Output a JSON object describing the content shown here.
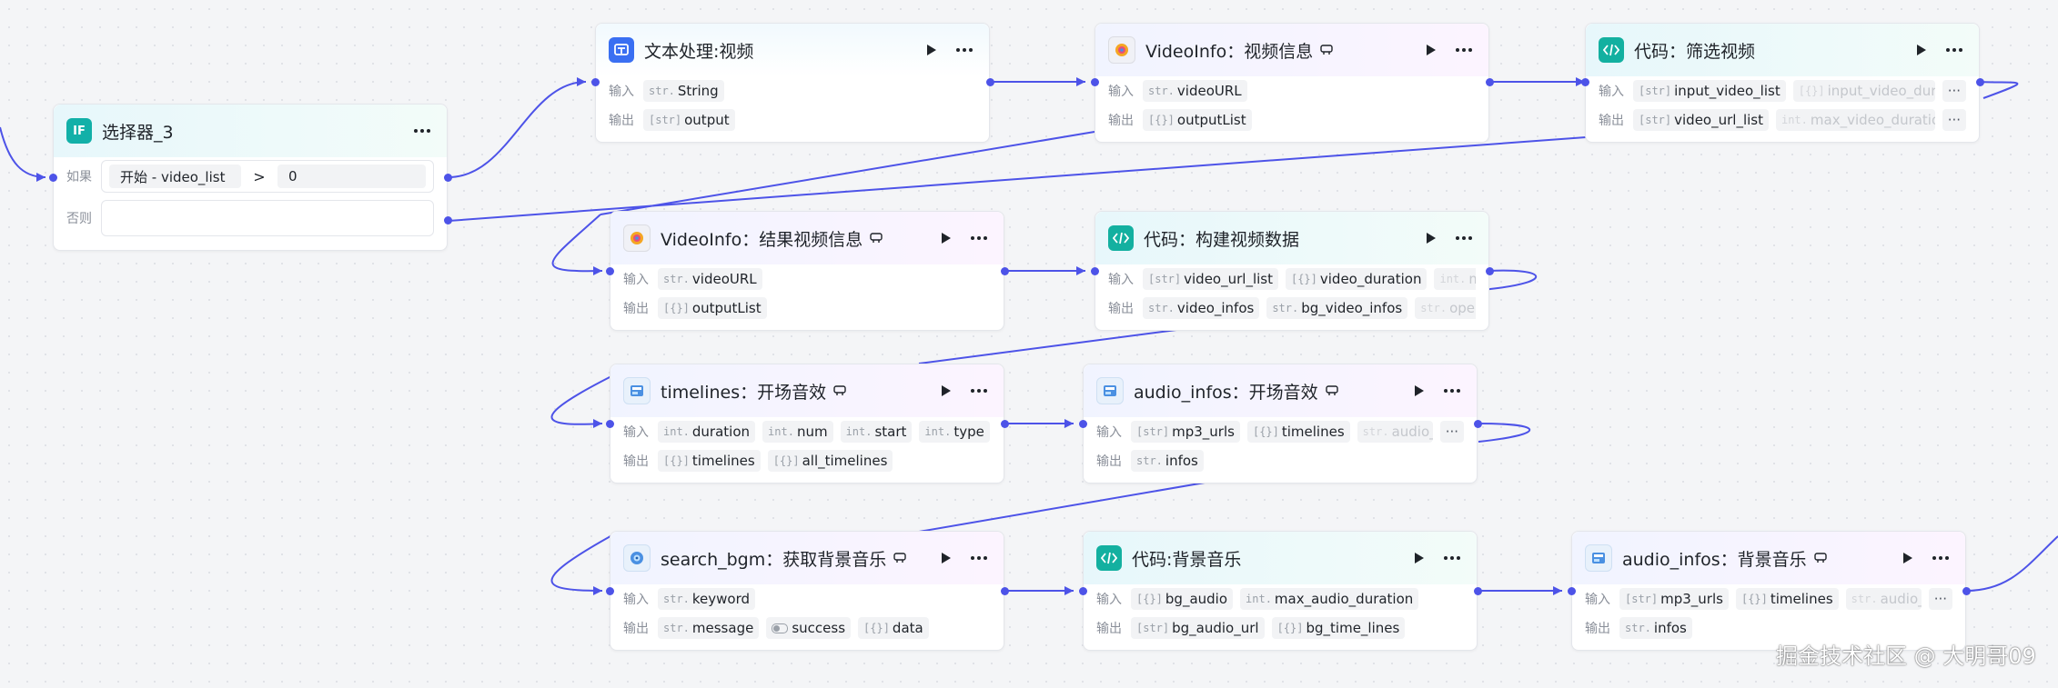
{
  "colors": {
    "accent": "#4d53e8",
    "edge": "#4d53e8",
    "canvas": "#f4f5f7"
  },
  "labels": {
    "input": "输入",
    "output": "输出",
    "if": "如果",
    "else": "否则"
  },
  "selector": {
    "title": "选择器_3",
    "icon_text": "IF",
    "condition": {
      "left": "开始  -  video_list",
      "operator": ">",
      "right": "0"
    }
  },
  "nodes": {
    "text_video": {
      "title": "文本处理:视频",
      "icon": "text-processing-icon",
      "inputs": [
        {
          "type": "str.",
          "name": "String"
        }
      ],
      "outputs": [
        {
          "type": "[str]",
          "name": "output"
        }
      ]
    },
    "videoinfo": {
      "title": "VideoInfo：视频信息",
      "icon": "videoinfo-plugin-icon",
      "inputs": [
        {
          "type": "str.",
          "name": "videoURL"
        }
      ],
      "outputs": [
        {
          "type": "[{}]",
          "name": "outputList"
        }
      ]
    },
    "code_filter": {
      "title": "代码：筛选视频",
      "icon": "code-icon",
      "inputs": [
        {
          "type": "[str]",
          "name": "input_video_list"
        },
        {
          "type": "[{}]",
          "name": "input_video_duration"
        }
      ],
      "outputs": [
        {
          "type": "[str]",
          "name": "video_url_list"
        },
        {
          "type": "int.",
          "name": "max_video_duration"
        }
      ]
    },
    "videoinfo_result": {
      "title": "VideoInfo：结果视频信息",
      "icon": "videoinfo-plugin-icon",
      "inputs": [
        {
          "type": "str.",
          "name": "videoURL"
        }
      ],
      "outputs": [
        {
          "type": "[{}]",
          "name": "outputList"
        }
      ]
    },
    "code_build": {
      "title": "代码：构建视频数据",
      "icon": "code-icon",
      "inputs": [
        {
          "type": "[str]",
          "name": "video_url_list"
        },
        {
          "type": "[{}]",
          "name": "video_duration"
        },
        {
          "type": "int.",
          "name": "m"
        }
      ],
      "outputs": [
        {
          "type": "str.",
          "name": "video_infos"
        },
        {
          "type": "str.",
          "name": "bg_video_infos"
        },
        {
          "type": "str.",
          "name": "ope"
        }
      ]
    },
    "timelines": {
      "title": "timelines：开场音效",
      "icon": "timelines-plugin-icon",
      "inputs": [
        {
          "type": "int.",
          "name": "duration"
        },
        {
          "type": "int.",
          "name": "num"
        },
        {
          "type": "int.",
          "name": "start"
        },
        {
          "type": "int.",
          "name": "type"
        }
      ],
      "outputs": [
        {
          "type": "[{}]",
          "name": "timelines"
        },
        {
          "type": "[{}]",
          "name": "all_timelines"
        }
      ]
    },
    "audio_infos_open": {
      "title": "audio_infos：开场音效",
      "icon": "audio-infos-plugin-icon",
      "inputs": [
        {
          "type": "[str]",
          "name": "mp3_urls"
        },
        {
          "type": "[{}]",
          "name": "timelines"
        },
        {
          "type": "str.",
          "name": "audio_effec"
        }
      ],
      "outputs": [
        {
          "type": "str.",
          "name": "infos"
        }
      ]
    },
    "search_bgm": {
      "title": "search_bgm：获取背景音乐",
      "icon": "search-bgm-plugin-icon",
      "inputs": [
        {
          "type": "str.",
          "name": "keyword"
        }
      ],
      "outputs": [
        {
          "type": "str.",
          "name": "message"
        },
        {
          "type": "toggle",
          "name": "success"
        },
        {
          "type": "[{}]",
          "name": "data"
        }
      ]
    },
    "code_bgm": {
      "title": "代码:背景音乐",
      "icon": "code-icon",
      "inputs": [
        {
          "type": "[{}]",
          "name": "bg_audio"
        },
        {
          "type": "int.",
          "name": "max_audio_duration"
        }
      ],
      "outputs": [
        {
          "type": "[str]",
          "name": "bg_audio_url"
        },
        {
          "type": "[{}]",
          "name": "bg_time_lines"
        }
      ]
    },
    "audio_infos_bgm": {
      "title": "audio_infos：背景音乐",
      "icon": "audio-infos-plugin-icon",
      "inputs": [
        {
          "type": "[str]",
          "name": "mp3_urls"
        },
        {
          "type": "[{}]",
          "name": "timelines"
        },
        {
          "type": "str.",
          "name": "audio_effec"
        }
      ],
      "outputs": [
        {
          "type": "str.",
          "name": "infos"
        }
      ]
    }
  },
  "watermark": "掘金技术社区 @ 大明哥09"
}
